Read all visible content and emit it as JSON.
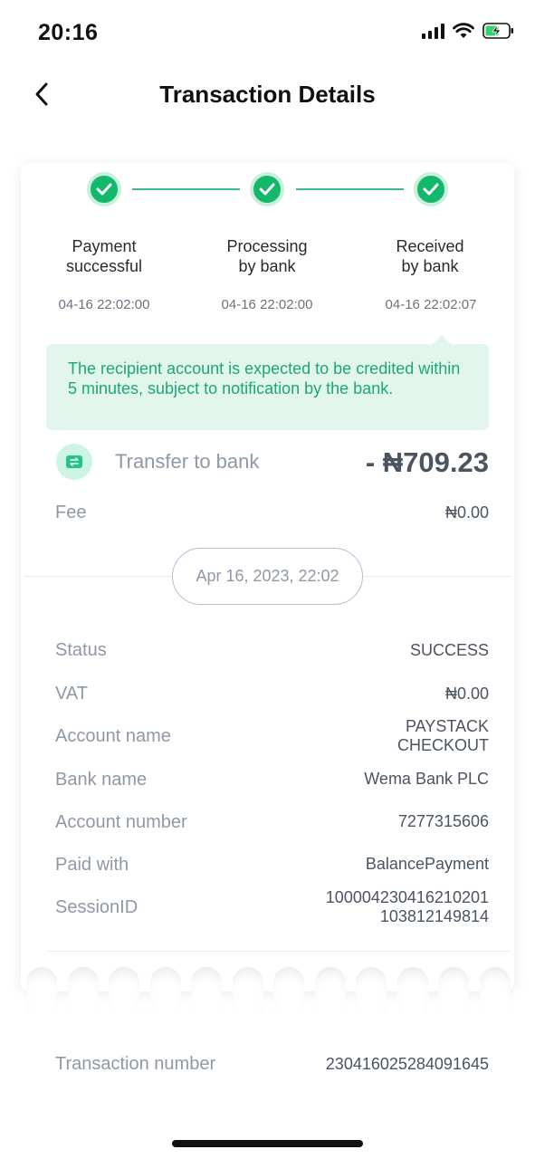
{
  "status_bar": {
    "time": "20:16"
  },
  "header": {
    "title": "Transaction Details"
  },
  "steps": [
    {
      "label_line1": "Payment",
      "label_line2": "successful",
      "time": "04-16 22:02:00"
    },
    {
      "label_line1": "Processing",
      "label_line2": "by bank",
      "time": "04-16 22:02:00"
    },
    {
      "label_line1": "Received",
      "label_line2": "by bank",
      "time": "04-16 22:02:07"
    }
  ],
  "notice": "The recipient account is expected to be credited within 5 minutes, subject to notification by the bank.",
  "transfer": {
    "label": "Transfer to bank",
    "amount": "- ₦709.23"
  },
  "fee": {
    "label": "Fee",
    "value": "₦0.00"
  },
  "date": "Apr 16, 2023, 22:02",
  "details": [
    {
      "label": "Status",
      "value_line1": "SUCCESS",
      "value_line2": ""
    },
    {
      "label": "VAT",
      "value_line1": "₦0.00",
      "value_line2": ""
    },
    {
      "label": "Account name",
      "value_line1": "PAYSTACK",
      "value_line2": "CHECKOUT"
    },
    {
      "label": "Bank name",
      "value_line1": "Wema Bank PLC",
      "value_line2": ""
    },
    {
      "label": "Account number",
      "value_line1": "7277315606",
      "value_line2": ""
    },
    {
      "label": "Paid with",
      "value_line1": "BalancePayment",
      "value_line2": ""
    },
    {
      "label": "SessionID",
      "value_line1": "100004230416210201",
      "value_line2": "103812149814"
    }
  ],
  "transaction_number": {
    "label": "Transaction number",
    "value": "230416025284091645"
  },
  "colors": {
    "accent_green": "#14b86a",
    "notice_bg": "#e3f6ee",
    "label_gray": "#8f98a5",
    "value_gray": "#4b5460"
  }
}
